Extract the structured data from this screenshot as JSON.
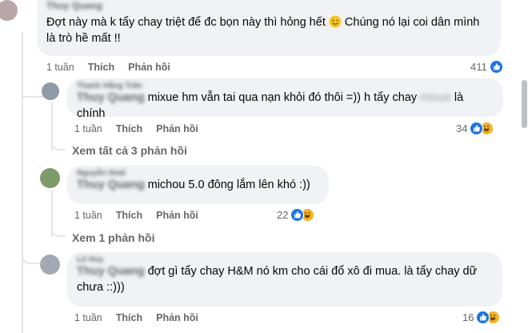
{
  "comments": [
    {
      "author": "Thuy Quang",
      "text_before": "Đợt này mà k tẩy chay triệt để đc bọn này thì hỏng hết ",
      "emoji": "smile-emoji",
      "text_after": " Chúng nó lại coi dân mình",
      "text_line2": "là trò hề mất !!",
      "time": "1 tuần",
      "like_label": "Thích",
      "reply_label": "Phản hồi",
      "reaction_count": "411",
      "reactions": [
        "like"
      ]
    },
    {
      "author": "Thanh Hằng Trần",
      "mention": "Thuy Quang",
      "text": " mixue hm vẫn tai qua nạn khỏi đó thôi =)) h tẩy chay ",
      "blurred_word": "mixue",
      "text_end": " là chính",
      "time": "1 tuần",
      "like_label": "Thích",
      "reply_label": "Phản hồi",
      "reaction_count": "34",
      "reactions": [
        "like",
        "haha"
      ],
      "view_replies": "Xem tất cả 3 phản hồi"
    },
    {
      "author": "Nguyễn Hoài",
      "mention": "Thuy Quang",
      "text": " michou 5.0 đông lắm lên khó :))",
      "time": "1 tuần",
      "like_label": "Thích",
      "reply_label": "Phản hồi",
      "reaction_count": "22",
      "reactions": [
        "like",
        "haha"
      ],
      "view_replies": "Xem 1 phản hồi"
    },
    {
      "author": "Lê Huy",
      "mention": "Thuy Quang",
      "text": " đợt gì tẩy chay H&M nó km cho cái đổ xô đi mua. là tẩy chay dữ",
      "text_line2": "chưa ::)))",
      "time": "1 tuần",
      "like_label": "Thích",
      "reply_label": "Phản hồi",
      "reaction_count": "16",
      "reactions": [
        "like",
        "haha"
      ]
    }
  ],
  "colors": {
    "bubble": "#f0f2f5",
    "meta_text": "#65676b",
    "like_blue": "#1b74e4",
    "haha_yellow": "#f7b125",
    "thread_line": "#e4e6eb"
  }
}
